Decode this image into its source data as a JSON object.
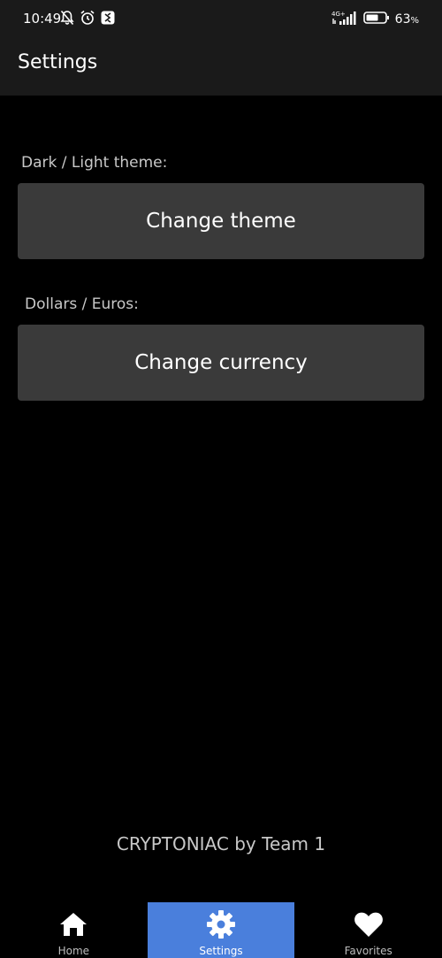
{
  "status_bar": {
    "time": "10:49",
    "network": "4G+",
    "battery_percent": "63",
    "battery_unit": "%"
  },
  "app_bar": {
    "title": "Settings"
  },
  "theme_section": {
    "label": "Dark / Light theme:",
    "button_label": "Change theme"
  },
  "currency_section": {
    "label": "Dollars / Euros:",
    "button_label": "Change currency"
  },
  "footer": {
    "credit": "CRYPTONIAC by Team 1"
  },
  "bottom_nav": {
    "items": [
      {
        "label": "Home",
        "icon": "home-icon",
        "active": false
      },
      {
        "label": "Settings",
        "icon": "gear-icon",
        "active": true
      },
      {
        "label": "Favorites",
        "icon": "heart-icon",
        "active": false
      }
    ]
  },
  "colors": {
    "background": "#000000",
    "bar_background": "#1a1a1a",
    "button_background": "#3a3a3a",
    "accent": "#4a7fdc"
  }
}
